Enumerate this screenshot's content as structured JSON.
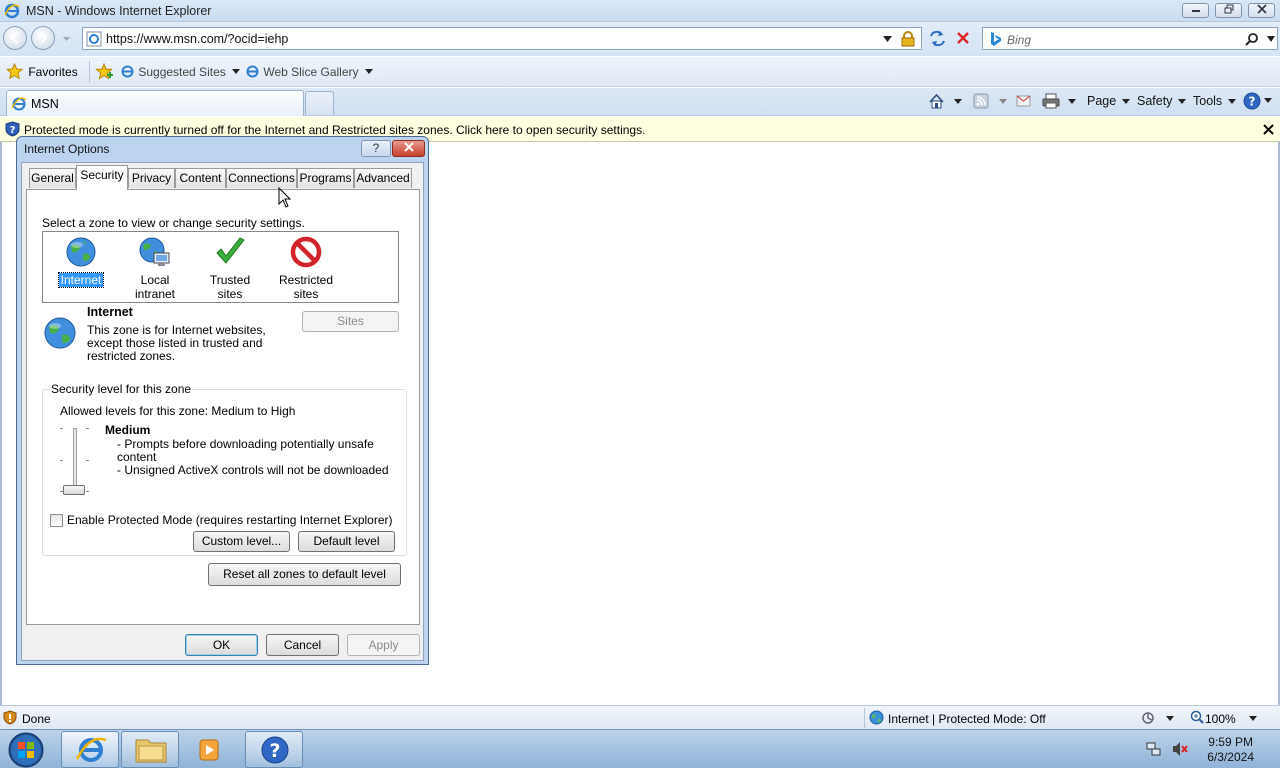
{
  "window": {
    "title": "MSN - Windows Internet Explorer"
  },
  "address_bar": {
    "url": "https://www.msn.com/?ocid=iehp"
  },
  "search": {
    "placeholder": "Bing"
  },
  "favorites_bar": {
    "favorites_label": "Favorites",
    "items": [
      {
        "label": "Suggested Sites"
      },
      {
        "label": "Web Slice Gallery"
      }
    ]
  },
  "tabs": [
    {
      "label": "MSN"
    }
  ],
  "command_bar": {
    "page": "Page",
    "safety": "Safety",
    "tools": "Tools"
  },
  "info_bar": {
    "message": "Protected mode is currently turned off for the Internet and Restricted sites zones.  Click here to open security settings."
  },
  "status_bar": {
    "status": "Done",
    "zone": "Internet | Protected Mode: Off",
    "zoom": "100%"
  },
  "taskbar": {
    "time": "9:59 PM",
    "date": "6/3/2024"
  },
  "dialog": {
    "title": "Internet Options",
    "help_glyph": "?",
    "tabs": [
      "General",
      "Security",
      "Privacy",
      "Content",
      "Connections",
      "Programs",
      "Advanced"
    ],
    "active_tab": "Security",
    "zone_prompt": "Select a zone to view or change security settings.",
    "zones": [
      {
        "label": "Internet",
        "icon": "globe-icon",
        "selected": true
      },
      {
        "label": "Local intranet",
        "icon": "intranet-globe-icon",
        "selected": false
      },
      {
        "label": "Trusted sites",
        "icon": "checkmark-icon",
        "selected": false
      },
      {
        "label": "Restricted\nsites",
        "icon": "no-entry-icon",
        "selected": false
      }
    ],
    "zone_detail": {
      "title": "Internet",
      "description_1": "This zone is for Internet websites,",
      "description_2": "except those listed in trusted and",
      "description_3": "restricted zones.",
      "sites_button": "Sites"
    },
    "security_level": {
      "group_label": "Security level for this zone",
      "allowed": "Allowed levels for this zone: Medium to High",
      "level_name": "Medium",
      "bullet_1a": "- Prompts before downloading potentially unsafe",
      "bullet_1b": "content",
      "bullet_2": "- Unsigned ActiveX controls will not be downloaded",
      "slider_level_fraction": 0.0,
      "protected_mode_label": "Enable Protected Mode (requires restarting Internet Explorer)",
      "protected_mode_checked": false,
      "custom_level_button": "Custom level...",
      "default_level_button": "Default level"
    },
    "reset_all_button": "Reset all zones to default level",
    "ok_button": "OK",
    "cancel_button": "Cancel",
    "apply_button": "Apply"
  }
}
